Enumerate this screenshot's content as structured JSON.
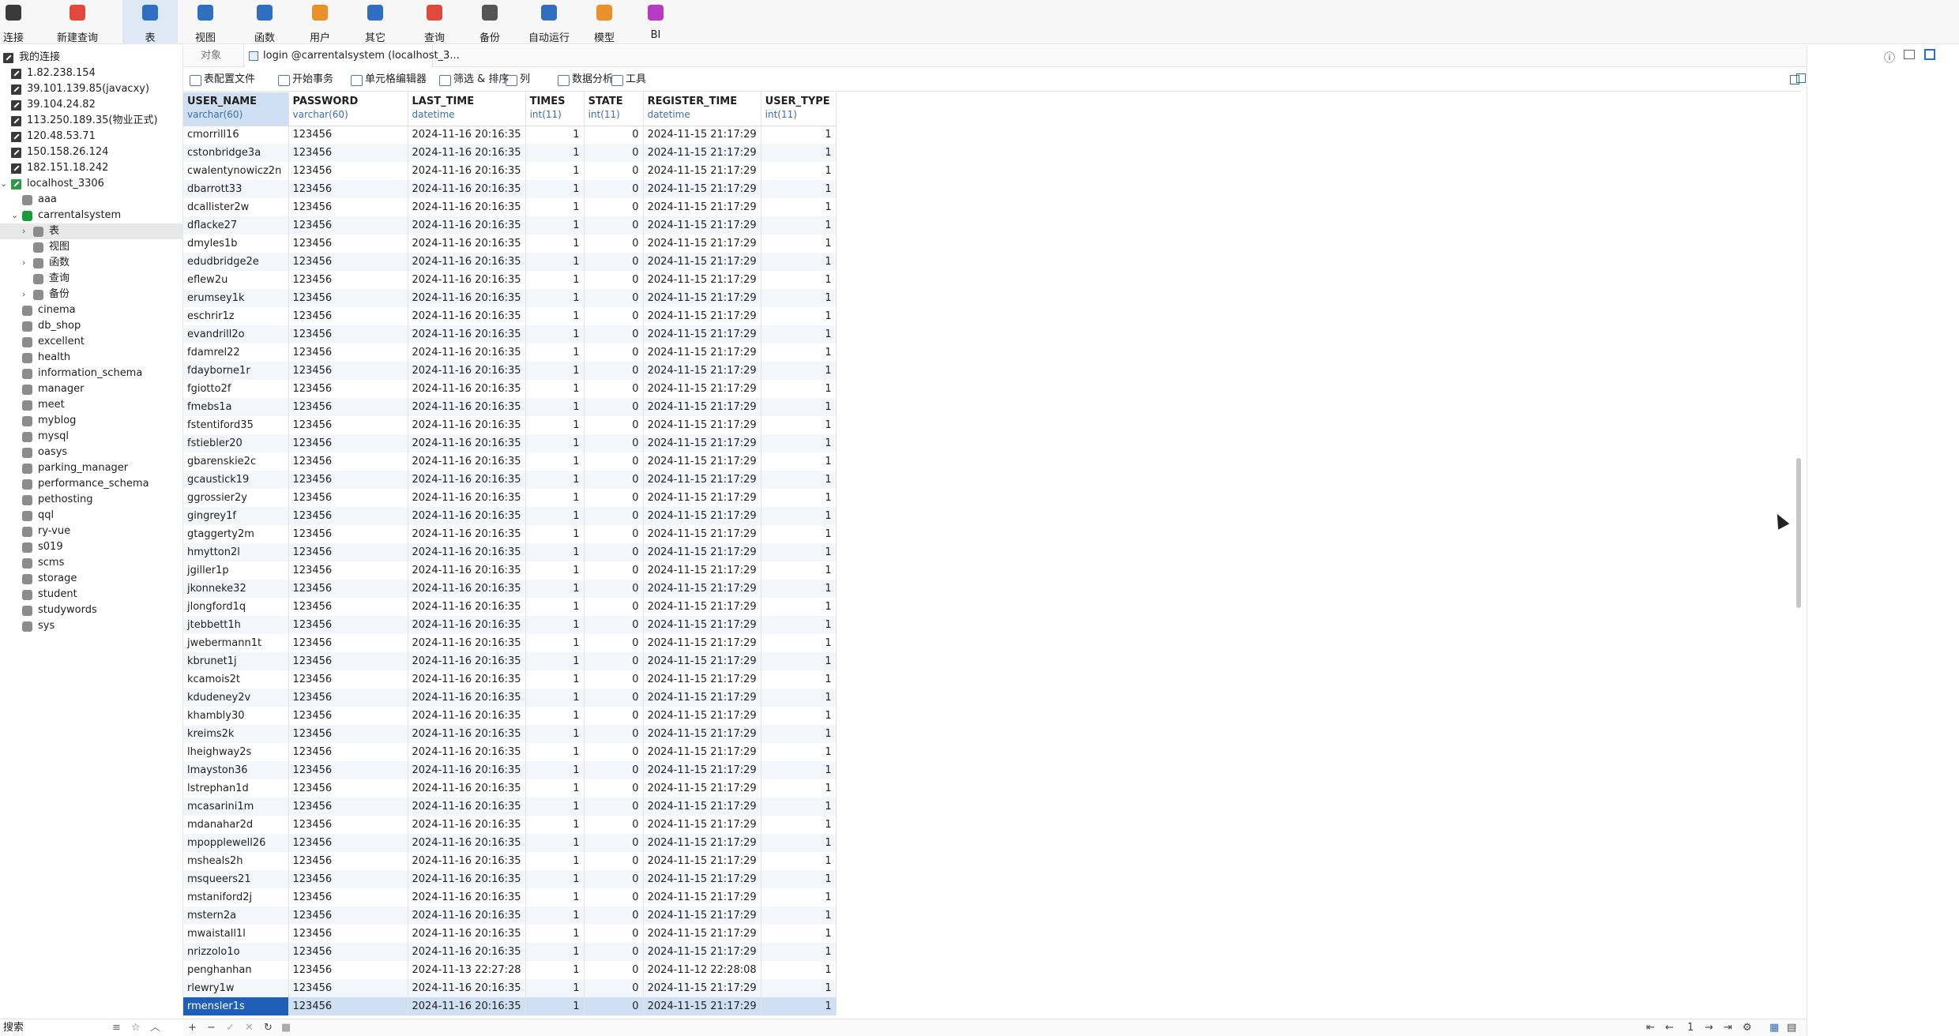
{
  "toolbar": {
    "items": [
      {
        "label": "连接",
        "icon": "connect-icon"
      },
      {
        "label": "新建查询",
        "icon": "new-query-icon"
      },
      {
        "label": "表",
        "icon": "table-icon",
        "active": true
      },
      {
        "label": "视图",
        "icon": "view-icon"
      },
      {
        "label": "函数",
        "icon": "function-icon"
      },
      {
        "label": "用户",
        "icon": "user-icon"
      },
      {
        "label": "其它",
        "icon": "other-icon"
      },
      {
        "label": "查询",
        "icon": "query-icon"
      },
      {
        "label": "备份",
        "icon": "backup-icon"
      },
      {
        "label": "自动运行",
        "icon": "automation-icon"
      },
      {
        "label": "模型",
        "icon": "model-icon"
      },
      {
        "label": "BI",
        "icon": "bi-icon"
      }
    ]
  },
  "nav": {
    "root": "我的连接",
    "connections": [
      "1.82.238.154",
      "39.101.139.85(javacxy)",
      "39.104.24.82",
      "113.250.189.35(物业正式)",
      "120.48.53.71",
      "150.158.26.124",
      "182.151.18.242"
    ],
    "local": "localhost_3306",
    "databases_before": [
      "aaa"
    ],
    "current_db": "carrentalsystem",
    "current_children": [
      "表",
      "视图",
      "函数",
      "查询",
      "备份"
    ],
    "databases_after": [
      "cinema",
      "db_shop",
      "excellent",
      "health",
      "information_schema",
      "manager",
      "meet",
      "myblog",
      "mysql",
      "oasys",
      "parking_manager",
      "performance_schema",
      "pethosting",
      "qql",
      "ry-vue",
      "s019",
      "scms",
      "storage",
      "student",
      "studywords",
      "sys"
    ],
    "search_label": "搜索"
  },
  "tabs": {
    "objects": "对象",
    "active": "login @carrentalsystem (localhost_3..."
  },
  "datatoolbar": {
    "items": [
      "表配置文件",
      "开始事务",
      "单元格编辑器",
      "筛选 & 排序",
      "列",
      "数据分析",
      "工具"
    ]
  },
  "grid": {
    "columns": [
      {
        "name": "USER_NAME",
        "type": "varchar(60)"
      },
      {
        "name": "PASSWORD",
        "type": "varchar(60)"
      },
      {
        "name": "LAST_TIME",
        "type": "datetime"
      },
      {
        "name": "TIMES",
        "type": "int(11)"
      },
      {
        "name": "STATE",
        "type": "int(11)"
      },
      {
        "name": "REGISTER_TIME",
        "type": "datetime"
      },
      {
        "name": "USER_TYPE",
        "type": "int(11)"
      }
    ],
    "rows": [
      [
        "cmorrill16",
        "123456",
        "2024-11-16 20:16:35",
        "1",
        "0",
        "2024-11-15 21:17:29",
        "1"
      ],
      [
        "cstonbridge3a",
        "123456",
        "2024-11-16 20:16:35",
        "1",
        "0",
        "2024-11-15 21:17:29",
        "1"
      ],
      [
        "cwalentynowicz2n",
        "123456",
        "2024-11-16 20:16:35",
        "1",
        "0",
        "2024-11-15 21:17:29",
        "1"
      ],
      [
        "dbarrott33",
        "123456",
        "2024-11-16 20:16:35",
        "1",
        "0",
        "2024-11-15 21:17:29",
        "1"
      ],
      [
        "dcallister2w",
        "123456",
        "2024-11-16 20:16:35",
        "1",
        "0",
        "2024-11-15 21:17:29",
        "1"
      ],
      [
        "dflacke27",
        "123456",
        "2024-11-16 20:16:35",
        "1",
        "0",
        "2024-11-15 21:17:29",
        "1"
      ],
      [
        "dmyles1b",
        "123456",
        "2024-11-16 20:16:35",
        "1",
        "0",
        "2024-11-15 21:17:29",
        "1"
      ],
      [
        "edudbridge2e",
        "123456",
        "2024-11-16 20:16:35",
        "1",
        "0",
        "2024-11-15 21:17:29",
        "1"
      ],
      [
        "eflew2u",
        "123456",
        "2024-11-16 20:16:35",
        "1",
        "0",
        "2024-11-15 21:17:29",
        "1"
      ],
      [
        "erumsey1k",
        "123456",
        "2024-11-16 20:16:35",
        "1",
        "0",
        "2024-11-15 21:17:29",
        "1"
      ],
      [
        "eschrir1z",
        "123456",
        "2024-11-16 20:16:35",
        "1",
        "0",
        "2024-11-15 21:17:29",
        "1"
      ],
      [
        "evandrill2o",
        "123456",
        "2024-11-16 20:16:35",
        "1",
        "0",
        "2024-11-15 21:17:29",
        "1"
      ],
      [
        "fdamrel22",
        "123456",
        "2024-11-16 20:16:35",
        "1",
        "0",
        "2024-11-15 21:17:29",
        "1"
      ],
      [
        "fdayborne1r",
        "123456",
        "2024-11-16 20:16:35",
        "1",
        "0",
        "2024-11-15 21:17:29",
        "1"
      ],
      [
        "fgiotto2f",
        "123456",
        "2024-11-16 20:16:35",
        "1",
        "0",
        "2024-11-15 21:17:29",
        "1"
      ],
      [
        "fmebs1a",
        "123456",
        "2024-11-16 20:16:35",
        "1",
        "0",
        "2024-11-15 21:17:29",
        "1"
      ],
      [
        "fstentiford35",
        "123456",
        "2024-11-16 20:16:35",
        "1",
        "0",
        "2024-11-15 21:17:29",
        "1"
      ],
      [
        "fstiebler20",
        "123456",
        "2024-11-16 20:16:35",
        "1",
        "0",
        "2024-11-15 21:17:29",
        "1"
      ],
      [
        "gbarenskie2c",
        "123456",
        "2024-11-16 20:16:35",
        "1",
        "0",
        "2024-11-15 21:17:29",
        "1"
      ],
      [
        "gcaustick19",
        "123456",
        "2024-11-16 20:16:35",
        "1",
        "0",
        "2024-11-15 21:17:29",
        "1"
      ],
      [
        "ggrossier2y",
        "123456",
        "2024-11-16 20:16:35",
        "1",
        "0",
        "2024-11-15 21:17:29",
        "1"
      ],
      [
        "gingrey1f",
        "123456",
        "2024-11-16 20:16:35",
        "1",
        "0",
        "2024-11-15 21:17:29",
        "1"
      ],
      [
        "gtaggerty2m",
        "123456",
        "2024-11-16 20:16:35",
        "1",
        "0",
        "2024-11-15 21:17:29",
        "1"
      ],
      [
        "hmytton2l",
        "123456",
        "2024-11-16 20:16:35",
        "1",
        "0",
        "2024-11-15 21:17:29",
        "1"
      ],
      [
        "jgiller1p",
        "123456",
        "2024-11-16 20:16:35",
        "1",
        "0",
        "2024-11-15 21:17:29",
        "1"
      ],
      [
        "jkonneke32",
        "123456",
        "2024-11-16 20:16:35",
        "1",
        "0",
        "2024-11-15 21:17:29",
        "1"
      ],
      [
        "jlongford1q",
        "123456",
        "2024-11-16 20:16:35",
        "1",
        "0",
        "2024-11-15 21:17:29",
        "1"
      ],
      [
        "jtebbett1h",
        "123456",
        "2024-11-16 20:16:35",
        "1",
        "0",
        "2024-11-15 21:17:29",
        "1"
      ],
      [
        "jwebermann1t",
        "123456",
        "2024-11-16 20:16:35",
        "1",
        "0",
        "2024-11-15 21:17:29",
        "1"
      ],
      [
        "kbrunet1j",
        "123456",
        "2024-11-16 20:16:35",
        "1",
        "0",
        "2024-11-15 21:17:29",
        "1"
      ],
      [
        "kcamois2t",
        "123456",
        "2024-11-16 20:16:35",
        "1",
        "0",
        "2024-11-15 21:17:29",
        "1"
      ],
      [
        "kdudeney2v",
        "123456",
        "2024-11-16 20:16:35",
        "1",
        "0",
        "2024-11-15 21:17:29",
        "1"
      ],
      [
        "khambly30",
        "123456",
        "2024-11-16 20:16:35",
        "1",
        "0",
        "2024-11-15 21:17:29",
        "1"
      ],
      [
        "kreims2k",
        "123456",
        "2024-11-16 20:16:35",
        "1",
        "0",
        "2024-11-15 21:17:29",
        "1"
      ],
      [
        "lheighway2s",
        "123456",
        "2024-11-16 20:16:35",
        "1",
        "0",
        "2024-11-15 21:17:29",
        "1"
      ],
      [
        "lmayston36",
        "123456",
        "2024-11-16 20:16:35",
        "1",
        "0",
        "2024-11-15 21:17:29",
        "1"
      ],
      [
        "lstrephan1d",
        "123456",
        "2024-11-16 20:16:35",
        "1",
        "0",
        "2024-11-15 21:17:29",
        "1"
      ],
      [
        "mcasarini1m",
        "123456",
        "2024-11-16 20:16:35",
        "1",
        "0",
        "2024-11-15 21:17:29",
        "1"
      ],
      [
        "mdanahar2d",
        "123456",
        "2024-11-16 20:16:35",
        "1",
        "0",
        "2024-11-15 21:17:29",
        "1"
      ],
      [
        "mpopplewell26",
        "123456",
        "2024-11-16 20:16:35",
        "1",
        "0",
        "2024-11-15 21:17:29",
        "1"
      ],
      [
        "msheals2h",
        "123456",
        "2024-11-16 20:16:35",
        "1",
        "0",
        "2024-11-15 21:17:29",
        "1"
      ],
      [
        "msqueers21",
        "123456",
        "2024-11-16 20:16:35",
        "1",
        "0",
        "2024-11-15 21:17:29",
        "1"
      ],
      [
        "mstaniford2j",
        "123456",
        "2024-11-16 20:16:35",
        "1",
        "0",
        "2024-11-15 21:17:29",
        "1"
      ],
      [
        "mstern2a",
        "123456",
        "2024-11-16 20:16:35",
        "1",
        "0",
        "2024-11-15 21:17:29",
        "1"
      ],
      [
        "mwaistall1l",
        "123456",
        "2024-11-16 20:16:35",
        "1",
        "0",
        "2024-11-15 21:17:29",
        "1"
      ],
      [
        "nrizzolo1o",
        "123456",
        "2024-11-16 20:16:35",
        "1",
        "0",
        "2024-11-15 21:17:29",
        "1"
      ],
      [
        "penghanhan",
        "123456",
        "2024-11-13 22:27:28",
        "1",
        "0",
        "2024-11-12 22:28:08",
        "1"
      ],
      [
        "rlewry1w",
        "123456",
        "2024-11-16 20:16:35",
        "1",
        "0",
        "2024-11-15 21:17:29",
        "1"
      ],
      [
        "rmensler1s",
        "123456",
        "2024-11-16 20:16:35",
        "1",
        "0",
        "2024-11-15 21:17:29",
        "1"
      ]
    ],
    "selected_row": 48
  },
  "pager": {
    "page": "1"
  },
  "colors": {
    "accent": "#1f5fb8",
    "selection": "#cfe0f5"
  }
}
